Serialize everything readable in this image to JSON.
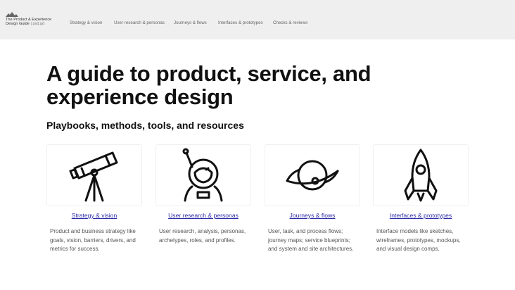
{
  "brand": {
    "line1": "The Product & Experience",
    "line2_main": "Design Guide",
    "line2_sep": " | ",
    "line2_sub": "pxd.gd",
    "logo_icon": "mountain-logo-icon"
  },
  "nav": [
    {
      "label": "Strategy & vision"
    },
    {
      "label": "User research & personas"
    },
    {
      "label": "Journeys & flows"
    },
    {
      "label": "Interfaces & prototypes"
    },
    {
      "label": "Checks & reviews"
    }
  ],
  "hero": {
    "title": "A guide to product, service, and experience design",
    "tagline": "Playbooks, methods, tools, and resources"
  },
  "cards": [
    {
      "icon": "telescope-icon",
      "label": "Strategy & vision",
      "desc": "Product and business strategy like goals, vision, barriers, drivers, and metrics for success."
    },
    {
      "icon": "astronaut-icon",
      "label": "User research & personas",
      "desc": "User research, analysis, personas, archetypes, roles, and profiles."
    },
    {
      "icon": "planet-icon",
      "label": "Journeys & flows",
      "desc": "User, task, and process flows; journey maps; service blueprints; and system and site architectures."
    },
    {
      "icon": "rocket-icon",
      "label": "Interfaces & prototypes",
      "desc": "Interface models like sketches, wireframes, prototypes, mockups, and visual design comps."
    }
  ],
  "colors": {
    "topbar_bg": "#efefef",
    "link": "#2a2aa8",
    "body_text": "#555555"
  }
}
